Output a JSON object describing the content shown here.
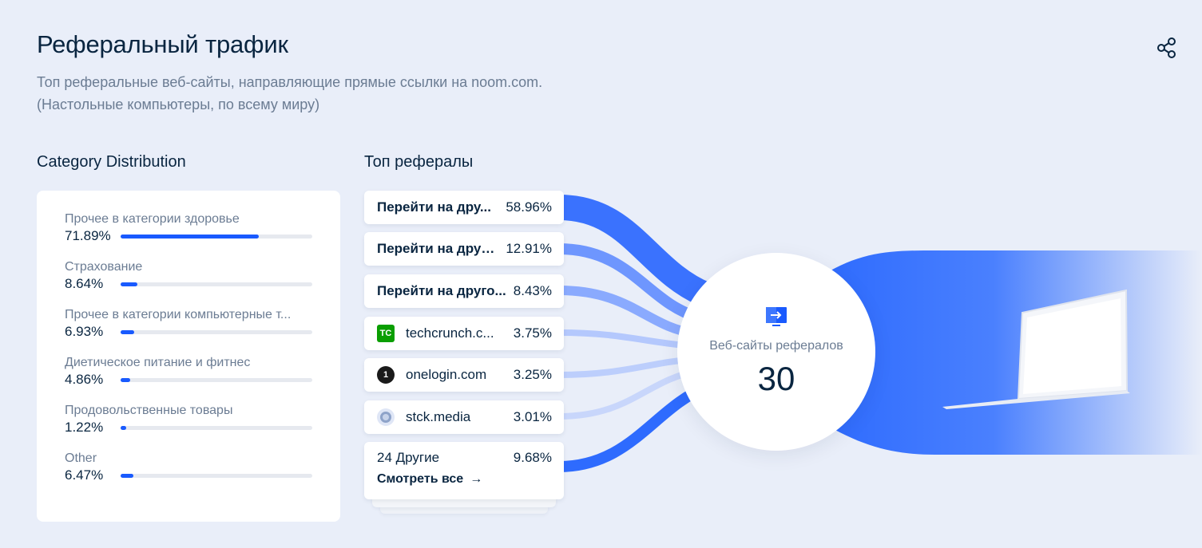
{
  "header": {
    "title": "Реферальный трафик",
    "subtitle_line1": "Топ реферальные веб-сайты, направляющие прямые ссылки на noom.com.",
    "subtitle_line2": "(Настольные компьютеры, по всему миру)"
  },
  "category_distribution": {
    "title": "Category Distribution",
    "items": [
      {
        "name": "Прочее в категории здоровье",
        "percent_label": "71.89%",
        "percent": 71.89
      },
      {
        "name": "Страхование",
        "percent_label": "8.64%",
        "percent": 8.64
      },
      {
        "name": "Прочее в категории компьютерные т...",
        "percent_label": "6.93%",
        "percent": 6.93
      },
      {
        "name": "Диетическое питание и фитнес",
        "percent_label": "4.86%",
        "percent": 4.86
      },
      {
        "name": "Продовольственные товары",
        "percent_label": "1.22%",
        "percent": 1.22
      },
      {
        "name": "Other",
        "percent_label": "6.47%",
        "percent": 6.47
      }
    ]
  },
  "top_referrals": {
    "title": "Топ рефералы",
    "items": [
      {
        "name": "Перейти на дру...",
        "percent_label": "58.96%",
        "icon": "none"
      },
      {
        "name": "Перейти на друго...",
        "percent_label": "12.91%",
        "icon": "none"
      },
      {
        "name": "Перейти на друго...",
        "percent_label": "8.43%",
        "icon": "none"
      },
      {
        "name": "techcrunch.c...",
        "percent_label": "3.75%",
        "icon": "techcrunch-favicon-icon"
      },
      {
        "name": "onelogin.com",
        "percent_label": "3.25%",
        "icon": "onelogin-favicon-icon"
      },
      {
        "name": "stck.media",
        "percent_label": "3.01%",
        "icon": "globe-icon"
      }
    ],
    "others": {
      "label": "24 Другие",
      "percent_label": "9.68%",
      "see_all": "Смотреть все"
    }
  },
  "summary": {
    "label": "Веб-сайты рефералов",
    "count": "30"
  },
  "colors": {
    "accent": "#195afe",
    "text": "#092540",
    "muted": "#6b7c93",
    "background": "#e9eef9"
  }
}
